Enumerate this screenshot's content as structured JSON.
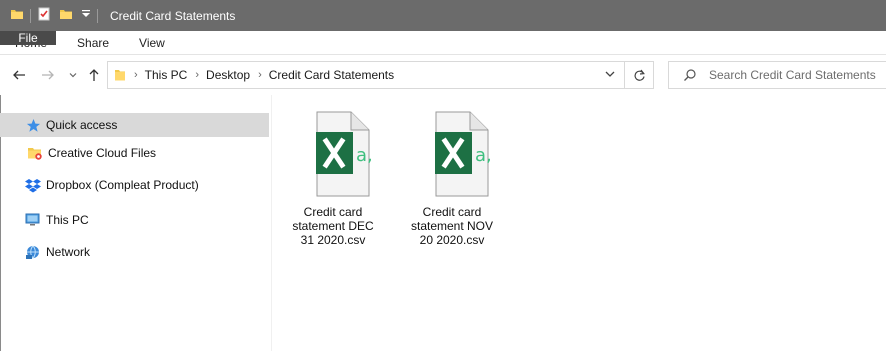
{
  "window": {
    "title": "Credit Card Statements"
  },
  "ribbon": {
    "tabs": [
      "File",
      "Home",
      "Share",
      "View"
    ]
  },
  "address": {
    "crumbs": [
      "This PC",
      "Desktop",
      "Credit Card Statements"
    ]
  },
  "search": {
    "placeholder": "Search Credit Card Statements"
  },
  "nav": {
    "items": [
      {
        "label": "Quick access",
        "icon": "star-icon",
        "selected": true
      },
      {
        "label": "Creative Cloud Files",
        "icon": "creative-cloud-folder-icon",
        "selected": false
      },
      {
        "label": "Dropbox (Compleat Product)",
        "icon": "dropbox-icon",
        "selected": false
      },
      {
        "label": "This PC",
        "icon": "computer-icon",
        "selected": false
      },
      {
        "label": "Network",
        "icon": "network-icon",
        "selected": false
      }
    ]
  },
  "files": [
    {
      "name_lines": [
        "Credit card",
        "statement DEC",
        "31 2020.csv"
      ],
      "icon": "excel-csv-icon"
    },
    {
      "name_lines": [
        "Credit card",
        "statement NOV",
        "20 2020.csv"
      ],
      "icon": "excel-csv-icon"
    }
  ],
  "colors": {
    "titlebar": "#6b6b6b",
    "file_tab": "#4a4a4a",
    "excel_green": "#1d7044",
    "csv_glyph": "#3fbf7f",
    "selected_nav": "#d9d9d9"
  }
}
